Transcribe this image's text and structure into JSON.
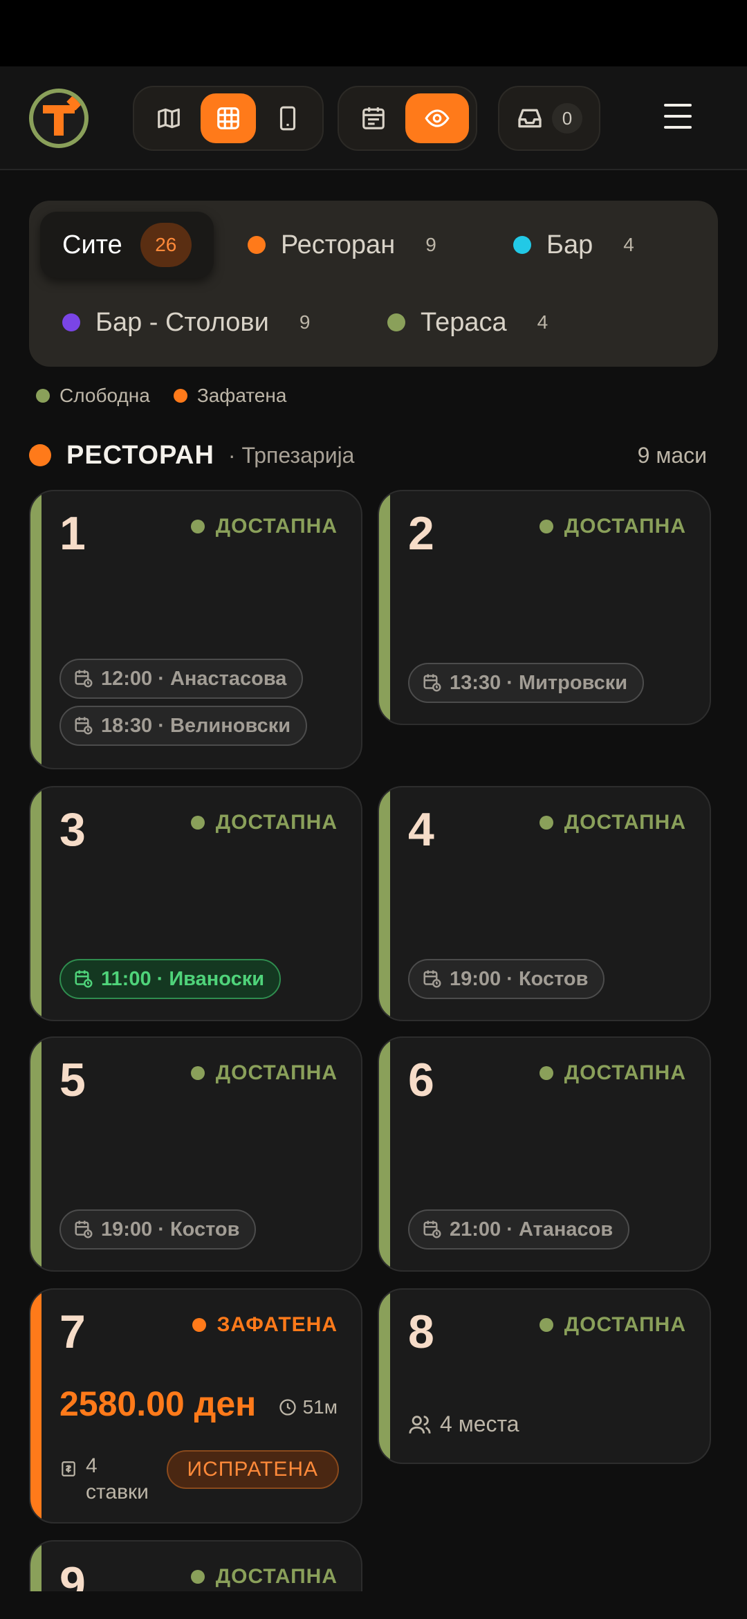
{
  "colors": {
    "accent": "#ff7a1a",
    "available": "#8aa05a",
    "bar": "#22c9e6",
    "bar_tables": "#7a45e6",
    "terrace": "#8aa05a",
    "reservation_green": "#4fd37a"
  },
  "toolbar": {
    "inbox_count": "0",
    "icons": [
      "map-icon",
      "grid-icon",
      "phone-icon",
      "calendar-icon",
      "eye-icon",
      "inbox-icon",
      "menu-icon"
    ]
  },
  "filters": {
    "all": {
      "label": "Сите",
      "count": "26"
    },
    "restaurant": {
      "label": "Ресторан",
      "count": "9"
    },
    "bar": {
      "label": "Бар",
      "count": "4"
    },
    "bar_tables": {
      "label": "Бар - Столови",
      "count": "9"
    },
    "terrace": {
      "label": "Тераса",
      "count": "4"
    }
  },
  "legend": {
    "free": "Слободна",
    "occupied": "Зафатена"
  },
  "section": {
    "title": "РЕСТОРАН",
    "subtitle": "· Трпезарија",
    "count": "9 маси"
  },
  "tables": [
    {
      "num": "1",
      "status": "ДОСТАПНА",
      "reservations": [
        "12:00 · Анастасова",
        "18:30 · Велиновски"
      ]
    },
    {
      "num": "2",
      "status": "ДОСТАПНА",
      "reservations": [
        "13:30 · Митровски"
      ]
    },
    {
      "num": "3",
      "status": "ДОСТАПНА",
      "reservations": [
        "11:00 · Иваноски"
      ]
    },
    {
      "num": "4",
      "status": "ДОСТАПНА",
      "reservations": [
        "19:00 · Костов"
      ]
    },
    {
      "num": "5",
      "status": "ДОСТАПНА",
      "reservations": [
        "19:00 · Костов"
      ]
    },
    {
      "num": "6",
      "status": "ДОСТАПНА",
      "reservations": [
        "21:00 · Атанасов"
      ]
    },
    {
      "num": "7",
      "status": "ЗАФАТЕНА",
      "amount": "2580.00 ден",
      "duration": "51м",
      "items_line1": "4",
      "items_line2": "ставки",
      "badge": "ИСПРАТЕНА"
    },
    {
      "num": "8",
      "status": "ДОСТАПНА",
      "seats": "4 места"
    },
    {
      "num": "9",
      "status": "ДОСТАПНА"
    }
  ]
}
